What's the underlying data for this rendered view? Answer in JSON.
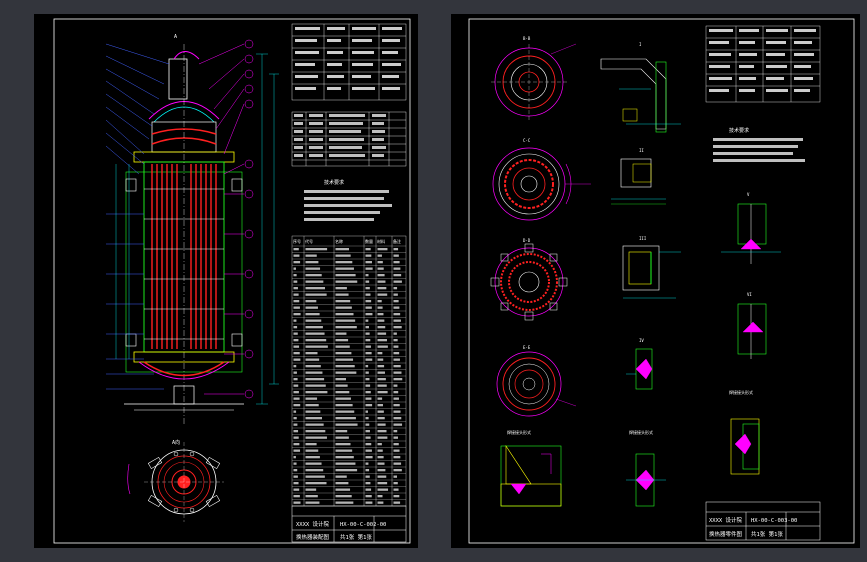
{
  "window": {
    "background": "#33353c"
  },
  "left_sheet": {
    "section_label": "A",
    "view_label": "A向",
    "notes_title": "技术要求",
    "parts_table_header": [
      "序号",
      "代号",
      "名称",
      "数量",
      "材料",
      "备注"
    ],
    "title_block": {
      "company": "XXXX 设计院",
      "drawing_no": "HX-00-C-002-00",
      "name": "换热器装配图",
      "sheet": "共1张 第1张"
    }
  },
  "right_sheet": {
    "views": [
      "B-B",
      "C-C",
      "D-D",
      "E-E",
      "I",
      "II",
      "III",
      "IV",
      "V",
      "VI"
    ],
    "notes_title": "技术要求",
    "weld_titles": [
      "焊接接头形式",
      "焊接接头形式",
      "焊接接头形式"
    ],
    "title_block": {
      "company": "XXXX 设计院",
      "drawing_no": "HX-00-C-003-00",
      "name": "换热器零件图",
      "sheet": "共1张 第1张"
    }
  },
  "colors": {
    "sheet_bg": "#000000",
    "border": "#ffffff",
    "red_tubes": "#ff2020",
    "green": "#20ff20",
    "magenta": "#ff00ff",
    "cyan": "#00ffff",
    "yellow": "#ffff00",
    "blue": "#4060ff"
  }
}
